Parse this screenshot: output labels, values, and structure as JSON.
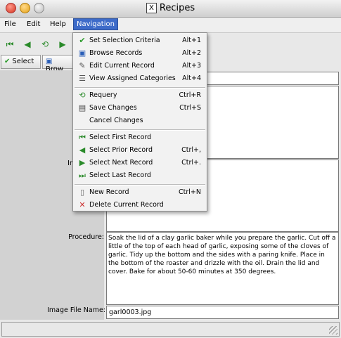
{
  "window": {
    "title": "Recipes",
    "x_logo": "X"
  },
  "menubar": {
    "items": [
      {
        "label": "File"
      },
      {
        "label": "Edit"
      },
      {
        "label": "Help"
      },
      {
        "label": "Navigation"
      }
    ]
  },
  "toolbar": {
    "select_label": "Select",
    "browse_label": "Brow"
  },
  "form": {
    "partial_label_i": "In",
    "procedure_label": "Procedure:",
    "procedure_text": "Soak the lid of a clay garlic baker while you prepare the garlic.  Cut off a little of the top of each head of garlic, exposing some of the cloves of garlic.  Tidy up the bottom and the sides with a paring knife.  Place in the bottom of the roaster and drizzle with the oil.  Drain the lid and cover.  Bake for about 50-60 minutes at 350 degrees.",
    "image_label": "Image File Name:",
    "image_value": "garl0003.jpg"
  },
  "navigation_menu": {
    "items": [
      {
        "label": "Set Selection Criteria",
        "accel": "Alt+1",
        "icon": "checkmark-icon"
      },
      {
        "label": "Browse Records",
        "accel": "Alt+2",
        "icon": "browse-icon"
      },
      {
        "label": "Edit Current Record",
        "accel": "Alt+3",
        "icon": "edit-icon"
      },
      {
        "label": "View Assigned Categories",
        "accel": "Alt+4",
        "icon": "list-icon"
      },
      {
        "label": "Requery",
        "accel": "Ctrl+R",
        "icon": "requery-icon"
      },
      {
        "label": "Save Changes",
        "accel": "Ctrl+S",
        "icon": "save-icon"
      },
      {
        "label": "Cancel Changes",
        "accel": "",
        "icon": ""
      },
      {
        "label": "Select First Record",
        "accel": "",
        "icon": "first-record-icon"
      },
      {
        "label": "Select Prior Record",
        "accel": "Ctrl+,",
        "icon": "prior-record-icon"
      },
      {
        "label": "Select Next Record",
        "accel": "Ctrl+.",
        "icon": "next-record-icon"
      },
      {
        "label": "Select Last Record",
        "accel": "",
        "icon": "last-record-icon"
      },
      {
        "label": "New Record",
        "accel": "Ctrl+N",
        "icon": "new-record-icon"
      },
      {
        "label": "Delete Current Record",
        "accel": "",
        "icon": "delete-record-icon"
      }
    ]
  }
}
